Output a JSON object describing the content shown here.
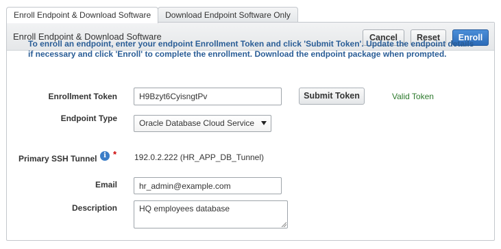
{
  "tabs": [
    {
      "label": "Enroll Endpoint & Download Software",
      "active": true
    },
    {
      "label": "Download Endpoint Software Only",
      "active": false
    }
  ],
  "panel": {
    "title": "Enroll Endpoint & Download Software",
    "buttons": {
      "cancel": "Cancel",
      "reset": "Reset",
      "enroll": "Enroll"
    }
  },
  "instructions": "To enroll an endpoint, enter your endpoint Enrollment Token and click 'Submit Token'. Update the endpoint details if necessary and click 'Enroll' to complete the enrollment. Download the endpoint package when prompted.",
  "form": {
    "enrollment_token": {
      "label": "Enrollment Token",
      "value": "H9Bzyt6CyisngtPv",
      "submit_label": "Submit Token",
      "status": "Valid Token"
    },
    "endpoint_type": {
      "label": "Endpoint Type",
      "value": "Oracle Database Cloud Service"
    },
    "ssh_tunnel": {
      "label": "Primary SSH Tunnel",
      "value": "192.0.2.222 (HR_APP_DB_Tunnel)",
      "required_mark": "*"
    },
    "email": {
      "label": "Email",
      "value": "hr_admin@example.com"
    },
    "description": {
      "label": "Description",
      "value": "HQ employees database"
    }
  },
  "colors": {
    "primary_button": "#2c6bb8",
    "instructions_text": "#2a5d96",
    "valid_text": "#2d7a2d",
    "required": "#cc0000"
  }
}
